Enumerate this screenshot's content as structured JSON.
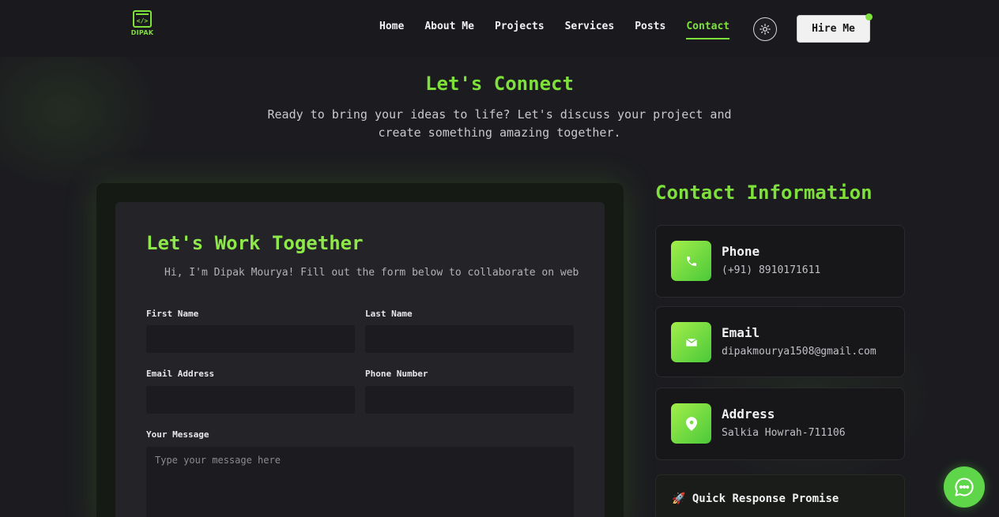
{
  "brand": {
    "logo_text": "DIPAK",
    "logo_code": "</>"
  },
  "nav": {
    "items": [
      {
        "label": "Home",
        "active": false
      },
      {
        "label": "About Me",
        "active": false
      },
      {
        "label": "Projects",
        "active": false
      },
      {
        "label": "Services",
        "active": false
      },
      {
        "label": "Posts",
        "active": false
      },
      {
        "label": "Contact",
        "active": true
      }
    ],
    "theme_toggle_icon": "sun-icon",
    "hire_label": "Hire Me"
  },
  "hero": {
    "title": "Let's Connect",
    "subtitle": "Ready to bring your ideas to life? Let's discuss your project and create something amazing together."
  },
  "form": {
    "title": "Let's Work Together",
    "intro": "Hi, I'm Dipak Mourya! Fill out the form below to collaborate on web",
    "first_name": {
      "label": "First Name",
      "value": "",
      "placeholder": ""
    },
    "last_name": {
      "label": "Last Name",
      "value": "",
      "placeholder": ""
    },
    "email": {
      "label": "Email Address",
      "value": "",
      "placeholder": ""
    },
    "phone": {
      "label": "Phone Number",
      "value": "",
      "placeholder": ""
    },
    "message": {
      "label": "Your Message",
      "value": "",
      "placeholder": "Type your message here"
    }
  },
  "contact_info": {
    "title": "Contact Information",
    "cards": [
      {
        "label": "Phone",
        "value": "(+91) 8910171611",
        "icon": "phone-icon"
      },
      {
        "label": "Email",
        "value": "dipakmourya1508@gmail.com",
        "icon": "envelope-icon"
      },
      {
        "label": "Address",
        "value": "Salkia Howrah-711106",
        "icon": "map-pin-icon"
      }
    ],
    "promise": {
      "emoji": "🚀",
      "title": "Quick Response Promise"
    }
  },
  "chat": {
    "icon": "chat-bubble-icon"
  },
  "colors": {
    "accent": "#7ee03a",
    "background": "#1c1c20",
    "card": "#242428"
  }
}
